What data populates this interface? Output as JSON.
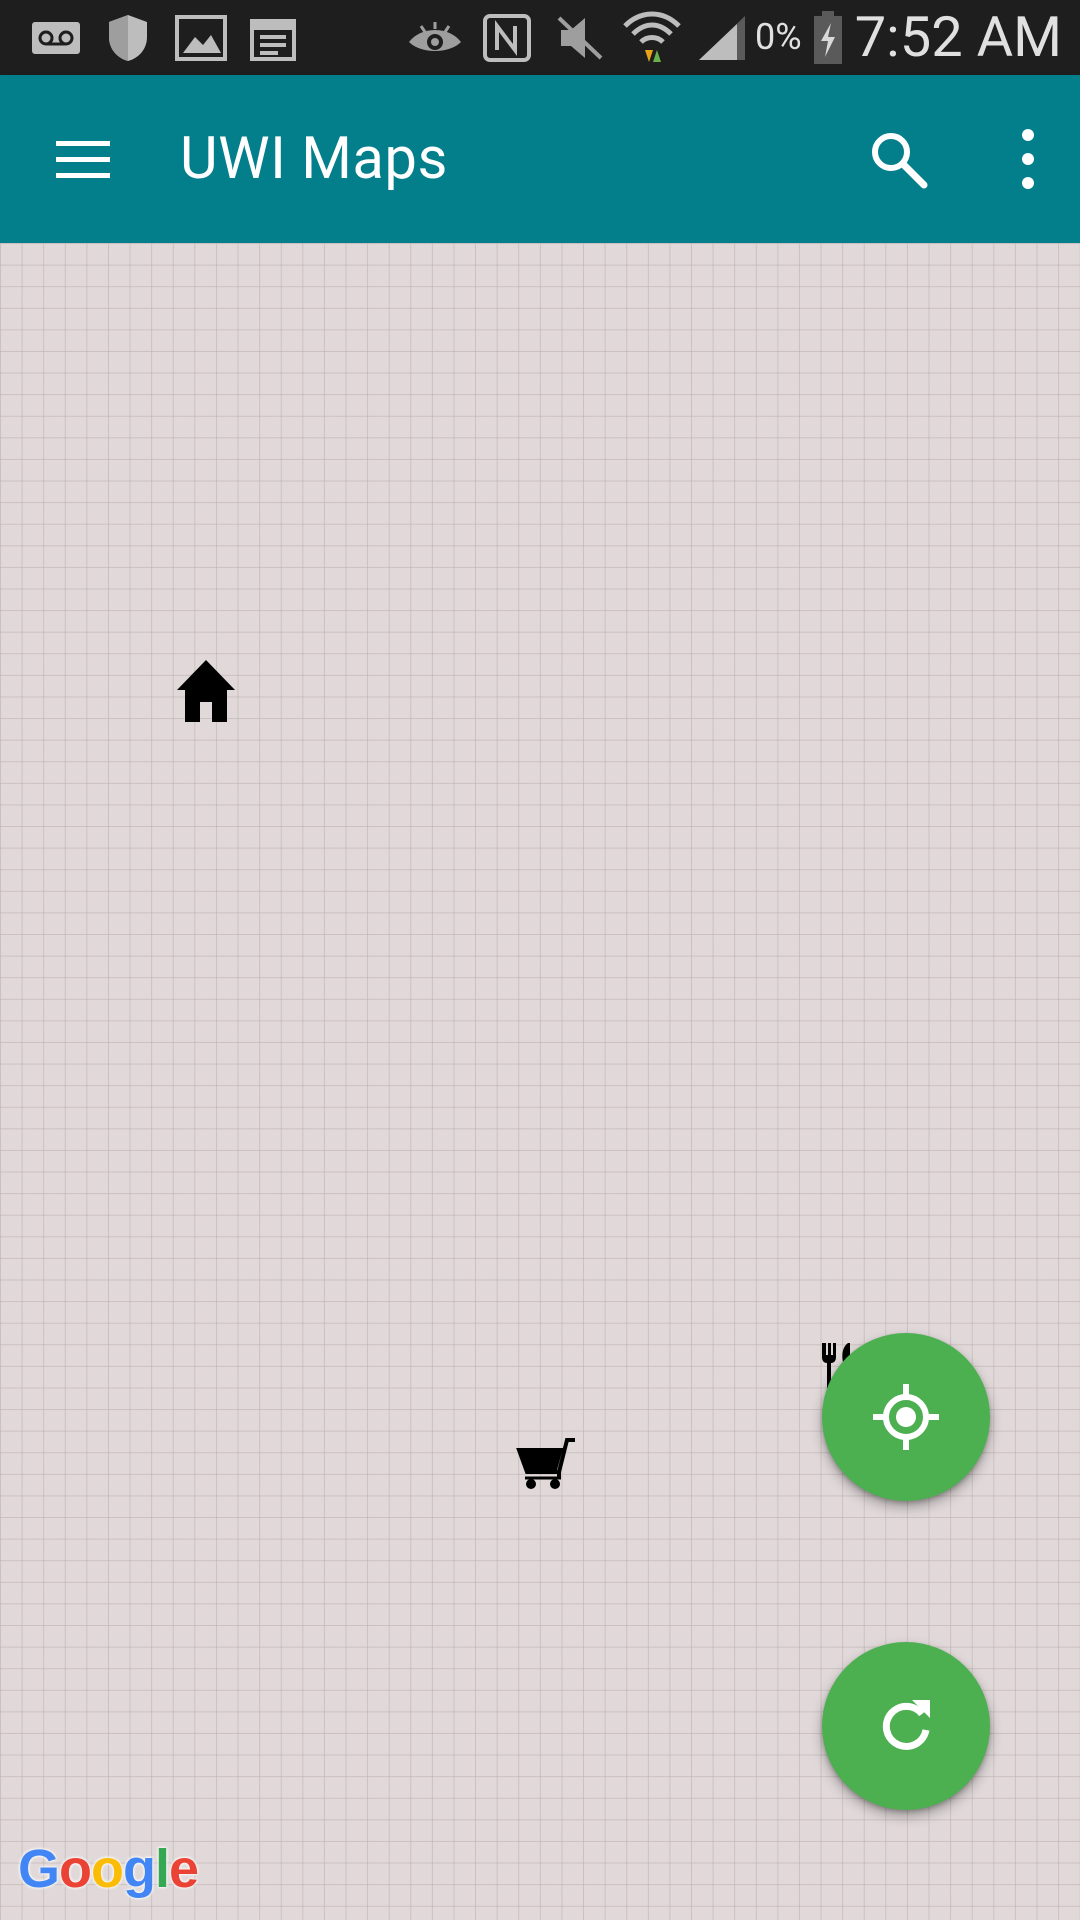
{
  "status_bar": {
    "battery_percent": "0%",
    "time": "7:52 AM",
    "icons": [
      "voicemail-icon",
      "shield-icon",
      "image-icon",
      "calendar-icon",
      "eye-icon",
      "nfc-icon",
      "mute-icon",
      "wifi-icon",
      "signal-icon",
      "battery-charging-icon"
    ]
  },
  "appbar": {
    "title": "UWI Maps",
    "color": "#037f8c",
    "menu_icon": "menu-icon",
    "search_icon": "search-icon",
    "overflow_icon": "more-vert-icon"
  },
  "map": {
    "markers": [
      {
        "name": "home-marker",
        "icon": "home-icon"
      },
      {
        "name": "restaurant-marker",
        "icon": "fork-knife-icon"
      },
      {
        "name": "shopping-marker",
        "icon": "shopping-cart-icon"
      }
    ],
    "attribution": {
      "letters": [
        "G",
        "o",
        "o",
        "g",
        "l",
        "e"
      ],
      "colors": [
        "#4285f4",
        "#ea4335",
        "#fbbc05",
        "#4285f4",
        "#34a853",
        "#ea4335"
      ]
    }
  },
  "fabs": {
    "color": "#4caf50",
    "locate_icon": "my-location-icon",
    "refresh_icon": "refresh-icon"
  }
}
